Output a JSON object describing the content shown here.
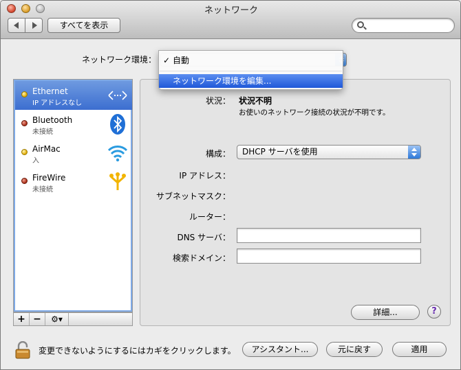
{
  "window": {
    "title": "ネットワーク"
  },
  "toolbar": {
    "show_all_label": "すべてを表示",
    "search_placeholder": ""
  },
  "location": {
    "label": "ネットワーク環境：",
    "menu": {
      "checked_item": "自動",
      "highlighted_item": "ネットワーク環境を編集..."
    }
  },
  "services": [
    {
      "name": "Ethernet",
      "status": "IP アドレスなし",
      "dot": "yellow",
      "icon": "ethernet-arrows-icon",
      "selected": true
    },
    {
      "name": "Bluetooth",
      "status": "未接続",
      "dot": "red",
      "icon": "bluetooth-icon",
      "selected": false
    },
    {
      "name": "AirMac",
      "status": "入",
      "dot": "yellow",
      "icon": "wifi-icon",
      "selected": false
    },
    {
      "name": "FireWire",
      "status": "未接続",
      "dot": "red",
      "icon": "firewire-icon",
      "selected": false
    }
  ],
  "detail": {
    "status_label": "状況：",
    "status_value": "状況不明",
    "status_desc": "お使いのネットワーク接続の状況が不明です。",
    "config_label": "構成：",
    "config_value": "DHCP サーバを使用",
    "ip_label": "IP アドレス：",
    "subnet_label": "サブネットマスク：",
    "router_label": "ルーター：",
    "dns_label": "DNS サーバ：",
    "search_domain_label": "検索ドメイン：",
    "dns_value": "",
    "search_domain_value": "",
    "advanced_label": "詳細...",
    "help_label": "?"
  },
  "footer": {
    "lock_text": "変更できないようにするにはカギをクリックします。",
    "assistant_label": "アシスタント...",
    "revert_label": "元に戻す",
    "apply_label": "適用"
  },
  "colors": {
    "selection": "#3c6ed0",
    "menu_highlight": "#1f58d8"
  }
}
